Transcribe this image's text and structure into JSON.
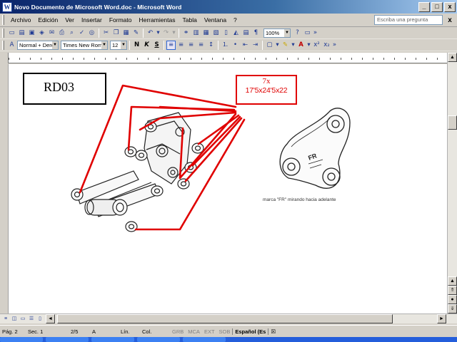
{
  "window": {
    "title": "Novo Documento de Microsoft Word.doc - Microsoft Word",
    "app_letter": "W",
    "controls": [
      "_",
      "□",
      "x"
    ]
  },
  "menu": {
    "items": [
      "Archivo",
      "Edición",
      "Ver",
      "Insertar",
      "Formato",
      "Herramientas",
      "Tabla",
      "Ventana",
      "?"
    ],
    "ask_placeholder": "Escriba una pregunta",
    "close_symbol": "x"
  },
  "toolbar_standard": {
    "zoom": "100%"
  },
  "toolbar_format": {
    "style": "Normal + Derec",
    "font": "Times New Roman",
    "size": "12",
    "bold": "N",
    "italic": "K",
    "underline": "S"
  },
  "document": {
    "label": "RD03",
    "quantity": "7x",
    "dimensions": "17'5x24'5x22",
    "caption": "marca \"FR\" mirando hacia adelante",
    "part_mark": "FR",
    "leader_color": "#e00000"
  },
  "statusbar": {
    "page": "Pág. 2",
    "section": "Sec. 1",
    "pages": "2/5",
    "at": "A",
    "line": "Lín.",
    "col": "Col.",
    "grb": "GRB",
    "mca": "MCA",
    "ext": "EXT",
    "sob": "SOB",
    "language": "Español (Es"
  }
}
